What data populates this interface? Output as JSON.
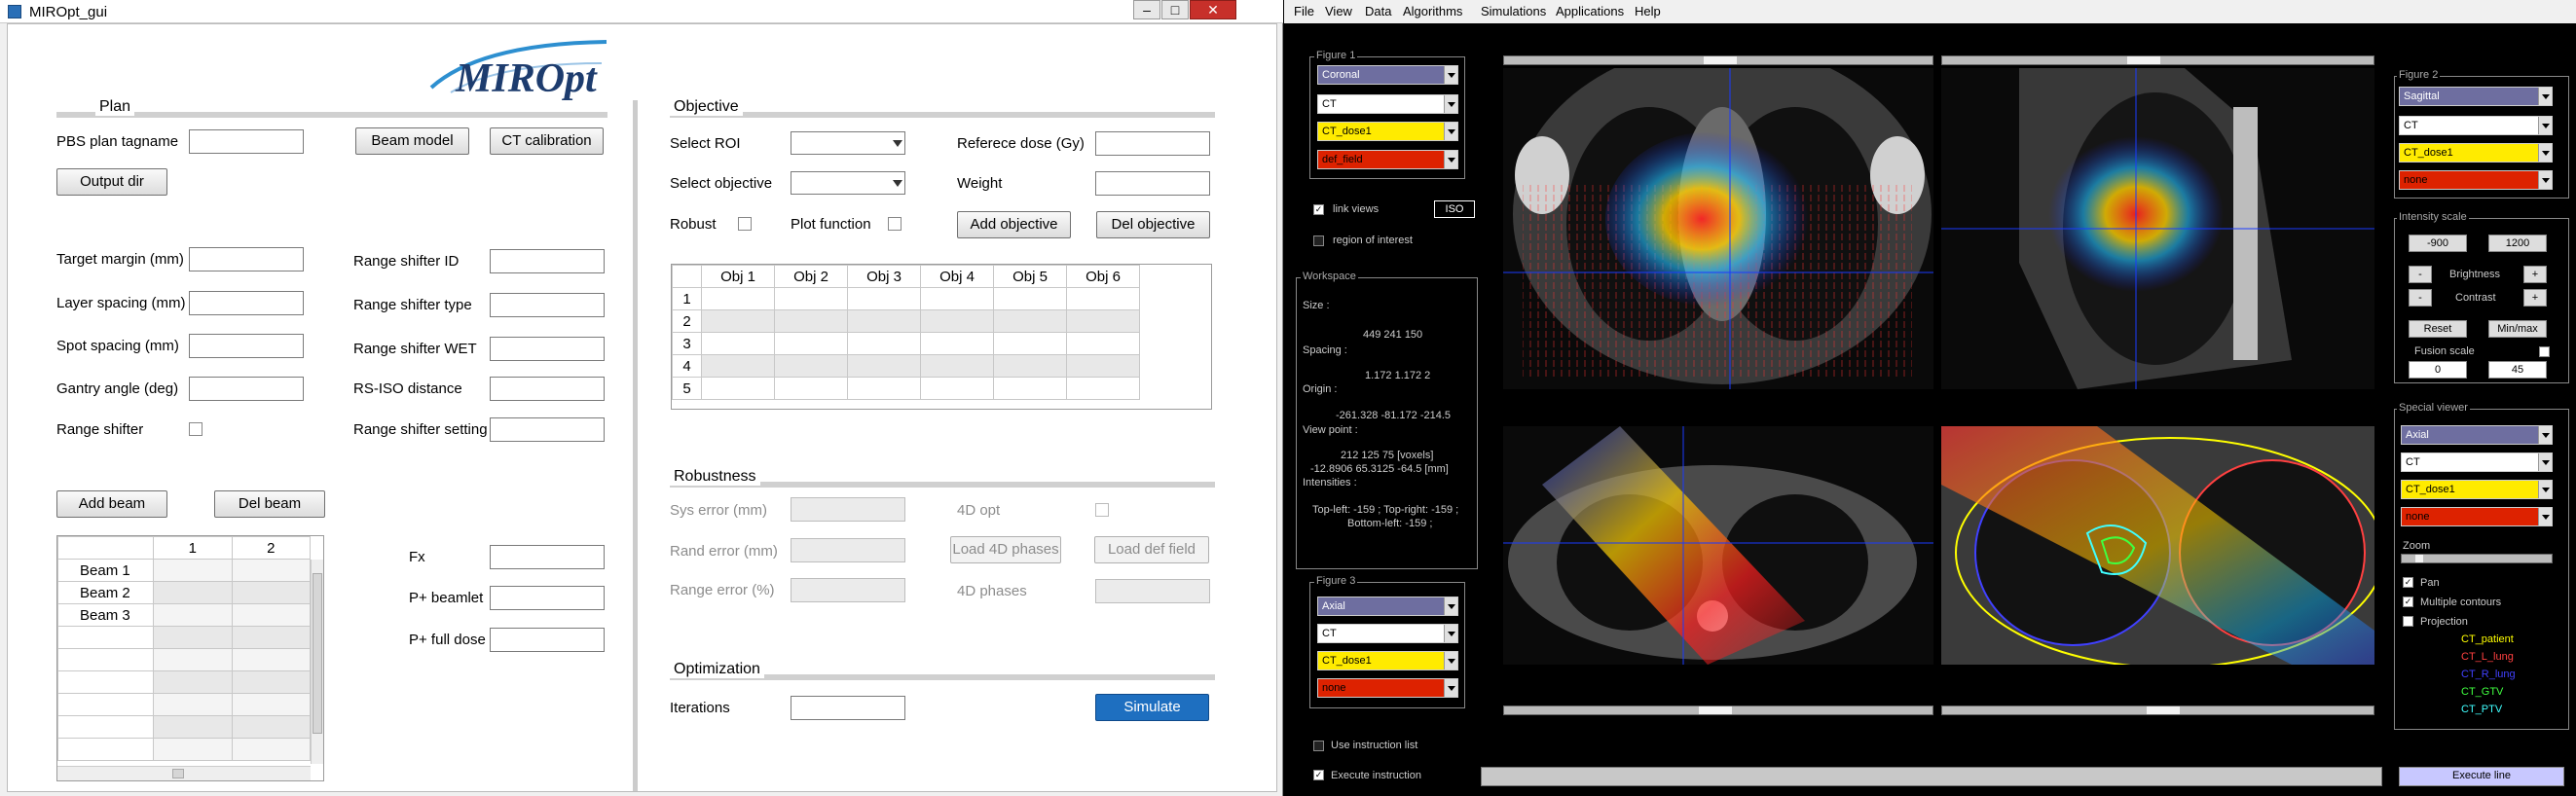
{
  "left_window": {
    "title": "MIROpt_gui",
    "controls": {
      "minimize": "–",
      "maximize": "□",
      "close": "✕"
    },
    "logo": "MIROpt",
    "plan": {
      "section": "Plan",
      "tagname_label": "PBS plan tagname",
      "beam_model": "Beam model",
      "ct_calibration": "CT calibration",
      "output_dir": "Output dir",
      "target_margin": "Target margin (mm)",
      "layer_spacing": "Layer spacing (mm)",
      "spot_spacing": "Spot spacing (mm)",
      "gantry_angle": "Gantry angle (deg)",
      "range_shifter": "Range shifter",
      "rs_id": "Range shifter ID",
      "rs_type": "Range shifter type",
      "rs_wet": "Range shifter WET",
      "rs_iso": "RS-ISO distance",
      "rs_setting": "Range shifter setting",
      "add_beam": "Add beam",
      "del_beam": "Del beam",
      "beam_cols": [
        "1",
        "2"
      ],
      "beams": [
        "Beam 1",
        "Beam 2",
        "Beam 3"
      ],
      "fx": "Fx",
      "p_beamlet": "P+ beamlet",
      "p_full": "P+ full dose"
    },
    "objective": {
      "section": "Objective",
      "select_roi": "Select ROI",
      "select_objective": "Select objective",
      "ref_dose": "Referece dose (Gy)",
      "weight": "Weight",
      "robust": "Robust",
      "plot_function": "Plot function",
      "add_objective": "Add objective",
      "del_objective": "Del objective",
      "cols": [
        "Obj 1",
        "Obj 2",
        "Obj 3",
        "Obj 4",
        "Obj 5",
        "Obj 6"
      ],
      "rows": [
        "1",
        "2",
        "3",
        "4",
        "5"
      ]
    },
    "robustness": {
      "section": "Robustness",
      "sys_error": "Sys error (mm)",
      "rand_error": "Rand error (mm)",
      "range_error": "Range error (%)",
      "opt4d": "4D opt",
      "load_4d": "Load 4D phases",
      "load_def": "Load def field",
      "phases4d": "4D phases"
    },
    "optimization": {
      "section": "Optimization",
      "iterations": "Iterations",
      "simulate": "Simulate"
    }
  },
  "right_window": {
    "menu": [
      "File",
      "View",
      "Data",
      "Algorithms",
      "Simulations",
      "Applications",
      "Help"
    ],
    "figure1": {
      "title": "Figure 1",
      "dropdowns": [
        "Coronal",
        "CT",
        "CT_dose1",
        "def_field"
      ]
    },
    "figure2": {
      "title": "Figure 2",
      "dropdowns": [
        "Sagittal",
        "CT",
        "CT_dose1",
        "none"
      ]
    },
    "figure3": {
      "title": "Figure 3",
      "dropdowns": [
        "Axial",
        "CT",
        "CT_dose1",
        "none"
      ]
    },
    "link_views": "link views",
    "iso": "ISO",
    "roi": "region of interest",
    "workspace": {
      "title": "Workspace",
      "size_label": "Size :",
      "size_val": "449  241  150",
      "spacing_label": "Spacing :",
      "spacing_val": "1.172  1.172  2",
      "origin_label": "Origin :",
      "origin_val": "-261.328  -81.172  -214.5",
      "viewpoint_label": "View point :",
      "viewpoint_val1": "212  125  75 [voxels]",
      "viewpoint_val2": "-12.8906  65.3125  -64.5 [mm]",
      "intensities_label": "Intensities :",
      "intensities_val1": "Top-left: -159 ; Top-right: -159 ;",
      "intensities_val2": "Bottom-left: -159 ;"
    },
    "intensity": {
      "title": "Intensity scale",
      "min": "-900",
      "max": "1200",
      "brightness": "Brightness",
      "contrast": "Contrast",
      "minus": "-",
      "plus": "+",
      "reset": "Reset",
      "minmax": "Min/max",
      "fusion": "Fusion scale",
      "f0": "0",
      "f1": "45"
    },
    "special": {
      "title": "Special viewer",
      "dropdowns": [
        "Axial",
        "CT",
        "CT_dose1",
        "none"
      ],
      "zoom": "Zoom",
      "pan": "Pan",
      "multiple": "Multiple contours",
      "projection": "Projection",
      "contours": [
        {
          "name": "CT_patient",
          "color": "#ffff00"
        },
        {
          "name": "CT_L_lung",
          "color": "#ff4040"
        },
        {
          "name": "CT_R_lung",
          "color": "#4040ff"
        },
        {
          "name": "CT_GTV",
          "color": "#40ff40"
        },
        {
          "name": "CT_PTV",
          "color": "#40ffff"
        }
      ]
    },
    "use_instruction": "Use instruction list",
    "execute_instruction": "Execute instruction",
    "execute_line": "Execute line",
    "colors": {
      "purple_dd": "#6e6ea0",
      "yellow_dd": "#ffeb00",
      "red_dd": "#dd2200",
      "simulate": "#1e6fc0",
      "exec": "#c8c8ff"
    }
  }
}
